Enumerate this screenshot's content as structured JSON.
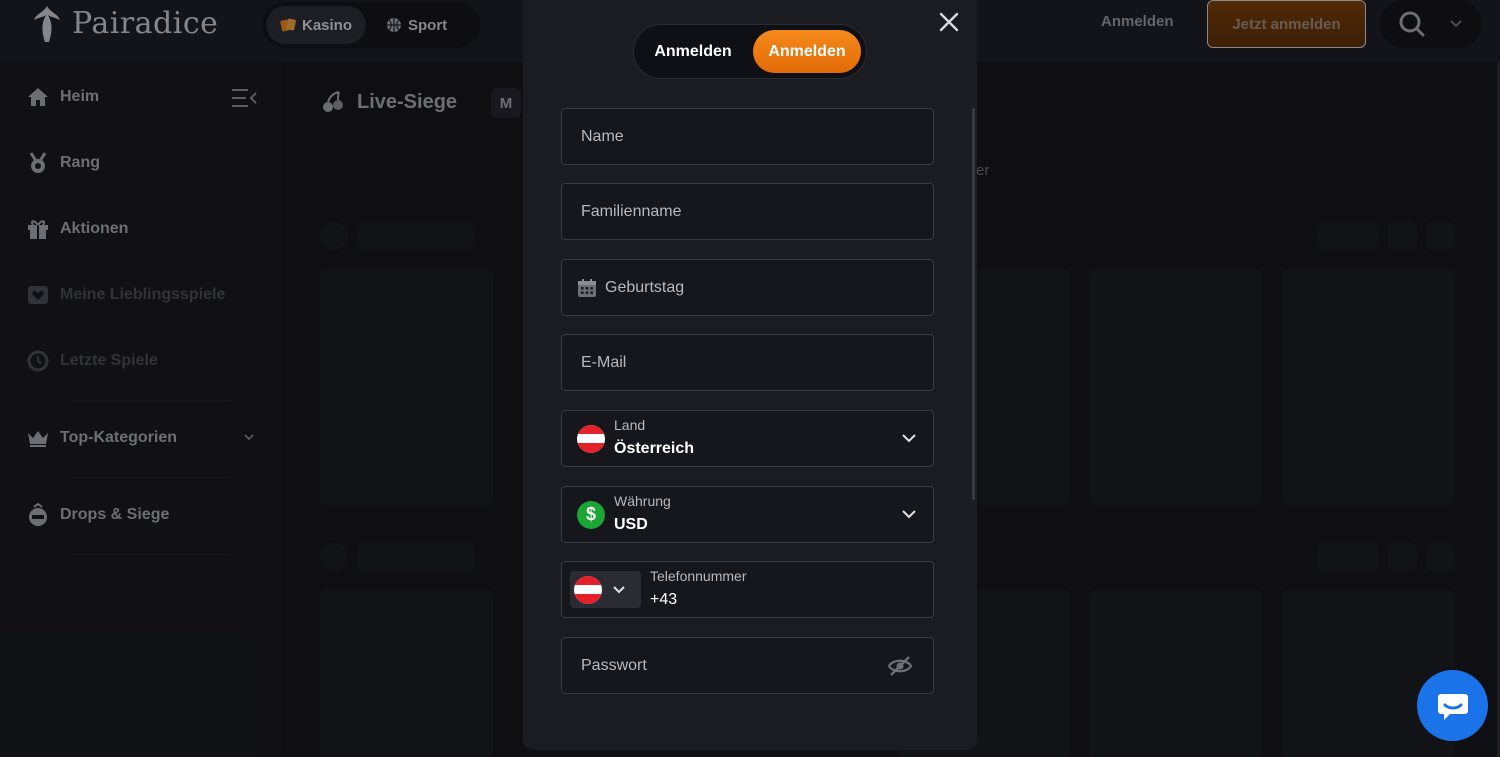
{
  "header": {
    "logo_text": "Pairadice",
    "nav": [
      {
        "label": "Kasino",
        "icon": "cards-icon"
      },
      {
        "label": "Sport",
        "icon": "basketball-icon"
      }
    ],
    "login_label": "Anmelden",
    "register_label": "Jetzt anmelden"
  },
  "sidebar": {
    "items": [
      {
        "label": "Heim",
        "icon": "home-icon"
      },
      {
        "label": "Rang",
        "icon": "medal-icon"
      },
      {
        "label": "Aktionen",
        "icon": "gift-icon"
      },
      {
        "label": "Meine Lieblingsspiele",
        "icon": "heart-icon"
      },
      {
        "label": "Letzte Spiele",
        "icon": "clock-icon"
      },
      {
        "label": "Top-Kategorien",
        "icon": "crown-icon"
      },
      {
        "label": "Drops & Siege",
        "icon": "drops-wins-icon"
      }
    ]
  },
  "main": {
    "title": "Live-Siege",
    "badge": "M",
    "fragment": "er"
  },
  "modal": {
    "tabs": [
      {
        "label": "Anmelden",
        "active": false
      },
      {
        "label": "Anmelden",
        "active": true
      }
    ],
    "fields": {
      "name_placeholder": "Name",
      "family_placeholder": "Familienname",
      "birthday_placeholder": "Geburtstag",
      "email_placeholder": "E-Mail",
      "country_label": "Land",
      "country_value": "Österreich",
      "currency_label": "Währung",
      "currency_value": "USD",
      "currency_symbol": "$",
      "phone_label": "Telefonnummer",
      "phone_value": "+43",
      "password_placeholder": "Passwort"
    }
  },
  "colors": {
    "accent": "#f07c12",
    "chat": "#1a73e8",
    "currency": "#1aa534"
  }
}
